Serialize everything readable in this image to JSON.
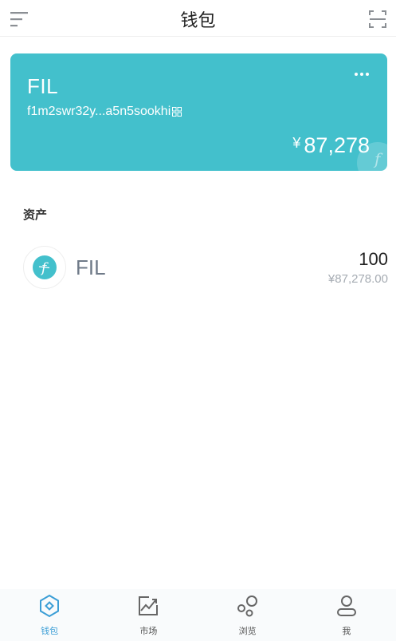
{
  "header": {
    "title": "钱包",
    "menu_icon": "menu-icon",
    "scan_icon": "scan-icon"
  },
  "wallet_card": {
    "name": "FIL",
    "address": "f1m2swr32y...a5n5sookhi",
    "currency_symbol": "¥",
    "balance": "87,278",
    "more_icon": "more-icon",
    "qr_icon": "qr-code-icon",
    "background_color": "#43c0cc"
  },
  "assets": {
    "title": "资产",
    "items": [
      {
        "symbol": "FIL",
        "amount": "100",
        "value": "¥87,278.00",
        "icon": "filecoin-icon",
        "icon_color": "#43c0cc"
      }
    ]
  },
  "tabbar": {
    "active_color": "#3b9ed6",
    "items": [
      {
        "label": "钱包",
        "icon": "wallet-icon",
        "active": true
      },
      {
        "label": "市场",
        "icon": "market-chart-icon",
        "active": false
      },
      {
        "label": "浏览",
        "icon": "browse-icon",
        "active": false
      },
      {
        "label": "我",
        "icon": "user-icon",
        "active": false
      }
    ]
  }
}
